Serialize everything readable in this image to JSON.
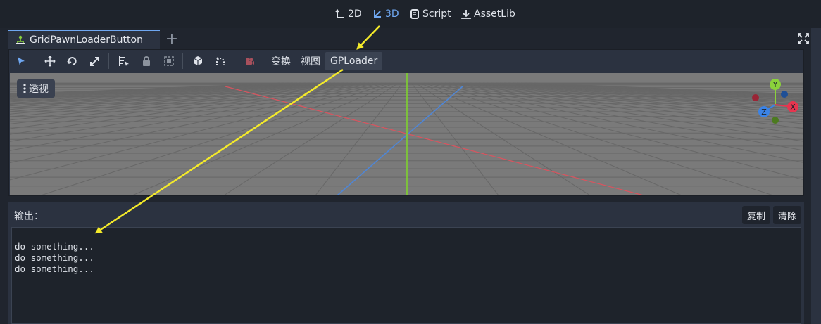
{
  "workspaces": [
    {
      "label": "2D",
      "icon": "2d-workspace-icon",
      "active": false
    },
    {
      "label": "3D",
      "icon": "3d-workspace-icon",
      "active": true
    },
    {
      "label": "Script",
      "icon": "script-icon",
      "active": false
    },
    {
      "label": "AssetLib",
      "icon": "download-icon",
      "active": false
    }
  ],
  "scene_tab": {
    "title": "GridPawnLoaderButton",
    "icon": "scene-tree-icon"
  },
  "toolbar": {
    "menus": [
      {
        "label": "变换"
      },
      {
        "label": "视图"
      },
      {
        "label": "GPLoader"
      }
    ]
  },
  "viewport": {
    "perspective_label": "透视",
    "gizmo_axes": [
      "Y",
      "X",
      "Z"
    ]
  },
  "output": {
    "title": "输出：",
    "copy_label": "复制",
    "clear_label": "清除",
    "lines": [
      "do something...",
      "do something...",
      "do something..."
    ]
  },
  "colors": {
    "accent": "#6fa7f1",
    "annotation_arrow": "#f4ea2a",
    "axis_x": "#e6354f",
    "axis_y": "#8ad13b",
    "axis_z": "#3b83e6"
  }
}
